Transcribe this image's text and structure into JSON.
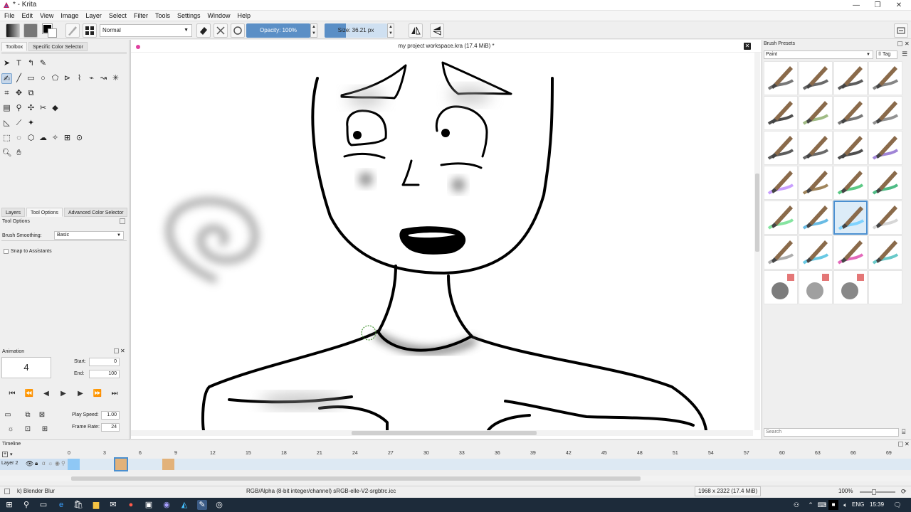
{
  "window": {
    "title": "* - Krita"
  },
  "menu": [
    "File",
    "Edit",
    "View",
    "Image",
    "Layer",
    "Select",
    "Filter",
    "Tools",
    "Settings",
    "Window",
    "Help"
  ],
  "toolbar": {
    "blend_mode": "Normal",
    "opacity_label": "Opacity:  100%",
    "opacity_value": 100,
    "size_label": "Size:  36.21 px"
  },
  "left_docker": {
    "tabs_top": [
      "Toolbox",
      "Specific Color Selector"
    ],
    "tabs_mid": [
      "Layers",
      "Tool Options",
      "Advanced Color Selector"
    ],
    "tool_options_title": "Tool Options",
    "brush_smoothing_label": "Brush Smoothing:",
    "brush_smoothing_value": "Basic",
    "snap_label": "Snap to Assistants"
  },
  "animation": {
    "title": "Animation",
    "current_frame": "4",
    "start_label": "Start:",
    "start_value": "0",
    "end_label": "End:",
    "end_value": "100",
    "play_speed_label": "Play Speed:",
    "play_speed_value": "1.00",
    "frame_rate_label": "Frame Rate:",
    "frame_rate_value": "24"
  },
  "document": {
    "title": "my project workspace.kra (17.4 MiB) *"
  },
  "brush_presets": {
    "title": "Brush Presets",
    "filter": "Paint",
    "tag_label": "Tag",
    "search_placeholder": "Search",
    "selected_index": 18
  },
  "timeline": {
    "title": "Timeline",
    "layer_name": "Layer 2",
    "ticks": [
      "0",
      "3",
      "6",
      "9",
      "12",
      "15",
      "18",
      "21",
      "24",
      "27",
      "30",
      "33",
      "36",
      "39",
      "42",
      "45",
      "48",
      "51",
      "54",
      "57",
      "60",
      "63",
      "66",
      "69"
    ]
  },
  "status": {
    "brush": "k) Blender Blur",
    "color_space": "RGB/Alpha (8-bit integer/channel)  sRGB-elle-V2-srgbtrc.icc",
    "dimensions": "1968 x 2322 (17.4 MiB)",
    "zoom": "100%"
  },
  "taskbar": {
    "lang": "ENG",
    "clock": "15:39"
  },
  "colors": {
    "accent": "#5b8fc6",
    "selection": "#4a8fd0",
    "keyframe": "#e2b27a"
  }
}
